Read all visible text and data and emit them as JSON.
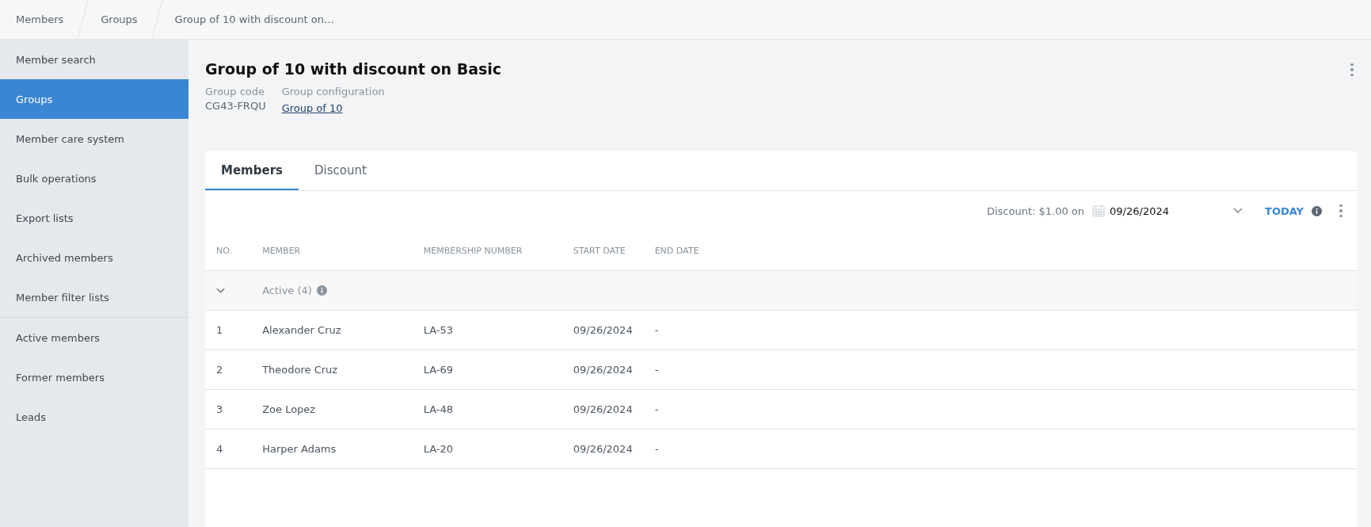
{
  "breadcrumbs": [
    "Members",
    "Groups",
    "Group of 10 with discount on…"
  ],
  "sidebar": {
    "sections": [
      {
        "items": [
          {
            "label": "Member search",
            "selected": false
          },
          {
            "label": "Groups",
            "selected": true
          },
          {
            "label": "Member care system",
            "selected": false
          },
          {
            "label": "Bulk operations",
            "selected": false
          },
          {
            "label": "Export lists",
            "selected": false
          },
          {
            "label": "Archived members",
            "selected": false
          },
          {
            "label": "Member filter lists",
            "selected": false
          }
        ]
      },
      {
        "items": [
          {
            "label": "Active members",
            "selected": false
          },
          {
            "label": "Former members",
            "selected": false
          },
          {
            "label": "Leads",
            "selected": false
          }
        ]
      }
    ]
  },
  "header": {
    "title": "Group of 10 with discount on Basic",
    "fields": [
      {
        "label": "Group code",
        "value": "CG43-FRQU",
        "kind": "text"
      },
      {
        "label": "Group configuration",
        "value": "Group of 10",
        "kind": "link"
      }
    ]
  },
  "tabs": [
    {
      "label": "Members",
      "selected": true
    },
    {
      "label": "Discount",
      "selected": false
    }
  ],
  "toolbar": {
    "discount_label": "Discount: $1.00 on",
    "date": "09/26/2024",
    "today": "TODAY"
  },
  "table": {
    "columns": [
      "NO.",
      "MEMBER",
      "MEMBERSHIP NUMBER",
      "START DATE",
      "END DATE"
    ],
    "groups": [
      {
        "label": "Active (4)",
        "expanded": true,
        "rows": [
          [
            "1",
            "Alexander Cruz",
            "LA-53",
            "09/26/2024",
            "-"
          ],
          [
            "2",
            "Theodore Cruz",
            "LA-69",
            "09/26/2024",
            "-"
          ],
          [
            "3",
            "Zoe Lopez",
            "LA-48",
            "09/26/2024",
            "-"
          ],
          [
            "4",
            "Harper Adams",
            "LA-20",
            "09/26/2024",
            "-"
          ]
        ]
      }
    ]
  }
}
